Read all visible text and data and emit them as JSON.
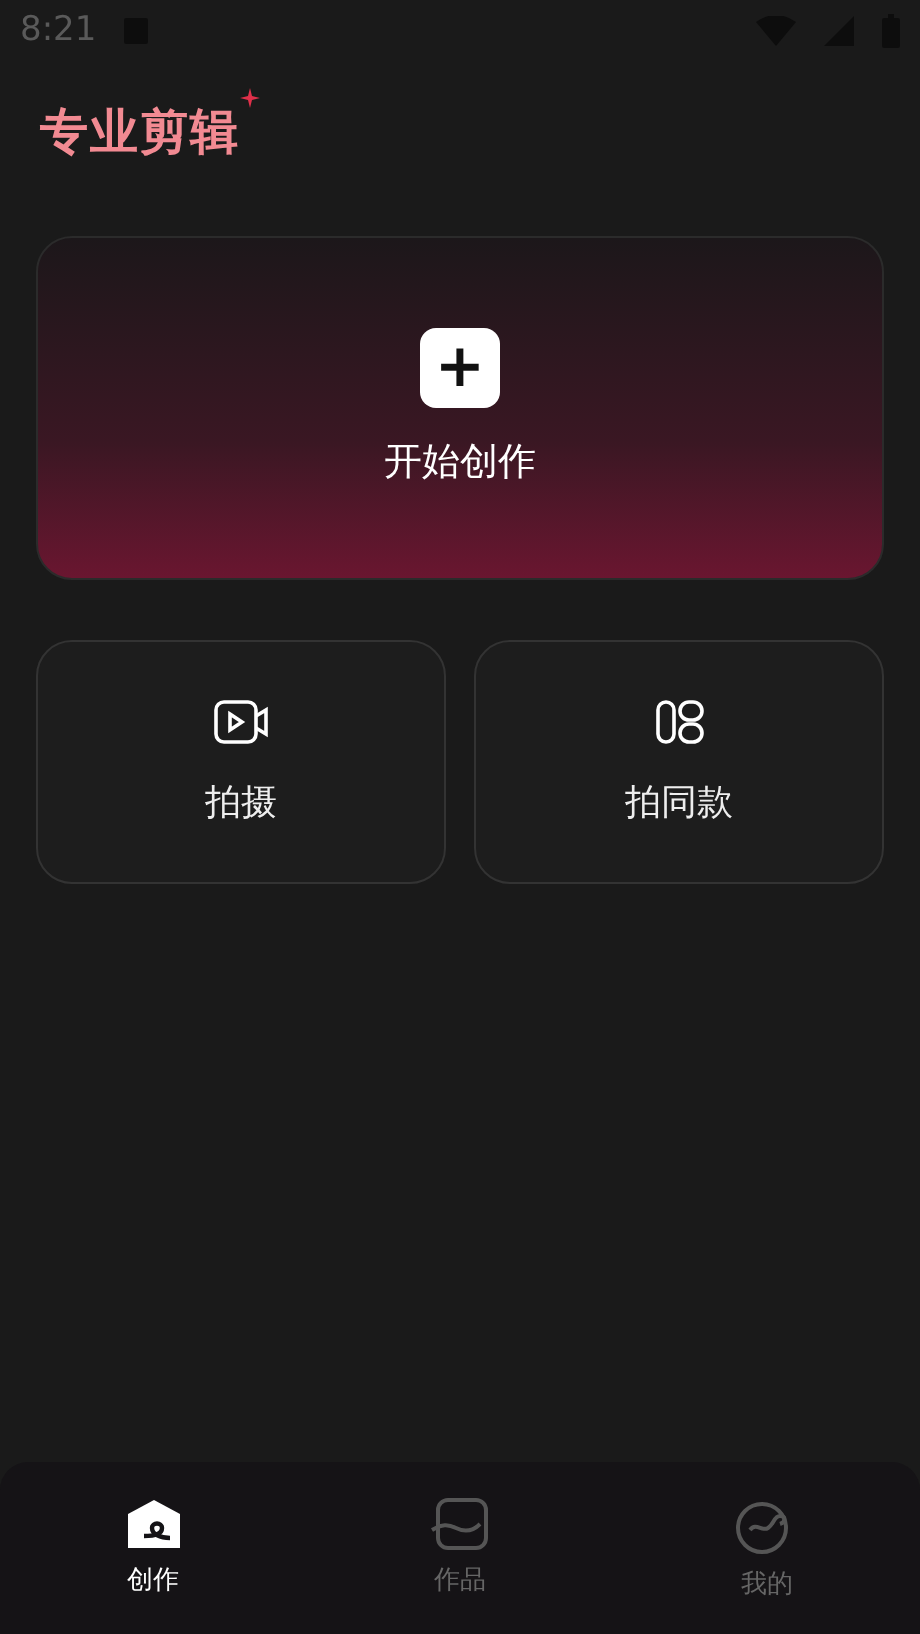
{
  "status_bar": {
    "time": "8:21"
  },
  "app_title": "专业剪辑",
  "create_card": {
    "icon": "+",
    "label": "开始创作"
  },
  "actions": [
    {
      "kind": "camera",
      "label": "拍摄"
    },
    {
      "kind": "template",
      "label": "拍同款"
    }
  ],
  "nav": [
    {
      "kind": "create",
      "label": "创作",
      "selected": true
    },
    {
      "kind": "works",
      "label": "作品",
      "selected": false
    },
    {
      "kind": "me",
      "label": "我的",
      "selected": false
    }
  ]
}
